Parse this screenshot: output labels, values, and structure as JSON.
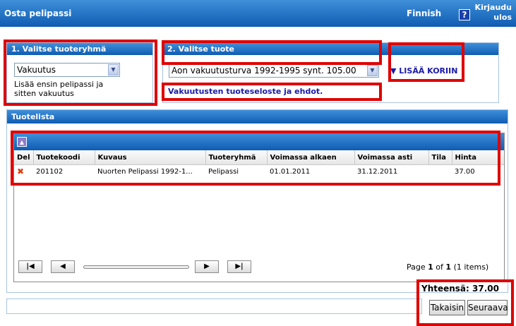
{
  "header": {
    "title": "Osta pelipassi",
    "language": "Finnish",
    "help_icon": "question-icon",
    "logout": "Kirjaudu ulos"
  },
  "group_panel": {
    "title": "1. Valitse tuoteryhmä",
    "selected": "Vakuutus",
    "hint": "Lisää ensin pelipassi ja sitten vakuutus"
  },
  "product_panel": {
    "title": "2. Valitse tuote",
    "selected": "Aon vakuutusturva 1992-1995 synt. 105.00",
    "terms_link": "Vakuutusten tuoteseloste ja ehdot.",
    "add_to_cart": "LISÄÄ KORIIN ▼"
  },
  "product_list": {
    "title": "Tuotelista",
    "columns": [
      "Del",
      "Tuotekoodi",
      "Kuvaus",
      "Tuoteryhmä",
      "Voimassa alkaen",
      "Voimassa asti",
      "Tila",
      "Hinta"
    ],
    "rows": [
      {
        "del_icon": "delete-x-icon",
        "code": "201102",
        "desc": "Nuorten Pelipassi 1992-1...",
        "group": "Pelipassi",
        "from": "01.01.2011",
        "to": "31.12.2011",
        "status": "",
        "price": "37.00"
      }
    ],
    "pager": {
      "page_prefix": "Page",
      "page": "1",
      "of_label": "of",
      "page_count": "1",
      "items": "(1 items)"
    }
  },
  "total": "Yhteensä: 37.00",
  "buttons": {
    "back": "Takaisin",
    "next": "Seuraava"
  }
}
